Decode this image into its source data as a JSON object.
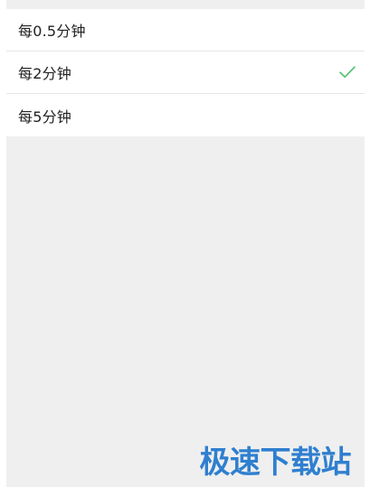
{
  "options": [
    {
      "label": "每0.5分钟",
      "selected": false
    },
    {
      "label": "每2分钟",
      "selected": true
    },
    {
      "label": "每5分钟",
      "selected": false
    }
  ],
  "colors": {
    "check": "#4cc06a",
    "watermark": "#2f7fd0",
    "background": "#efefef"
  },
  "watermark": {
    "text": "极速下载站"
  }
}
